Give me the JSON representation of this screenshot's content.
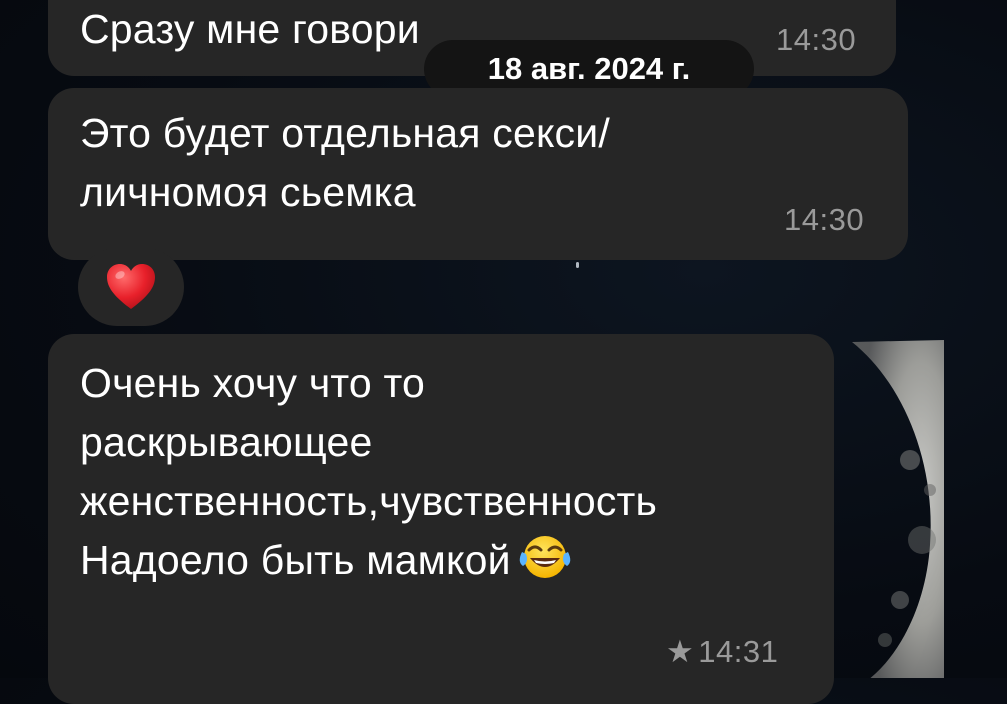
{
  "messages": [
    {
      "text": "Сразу мне говори",
      "time": "14:30"
    },
    {
      "text": "Это будет отдельная секси/\nличномоя сьемка",
      "time": "14:30",
      "reaction": "heart-emoji"
    },
    {
      "text": "Очень хочу что то\nраскрывающее\nженственность,чувственность\nНадоело быть мамкой",
      "emoji": "tears-of-joy-emoji",
      "time": "14:31",
      "starred": true
    }
  ],
  "date_separator": "18 авг. 2024 г.",
  "colors": {
    "bubble": "#262626",
    "background": "#070b12",
    "time_text": "#9a9a9a",
    "date_pill": "#141414",
    "reaction_heart": "#e8202a"
  },
  "icons": {
    "star_marker": "star-icon",
    "heart": "heart-icon",
    "laugh": "tears-of-joy-icon"
  }
}
